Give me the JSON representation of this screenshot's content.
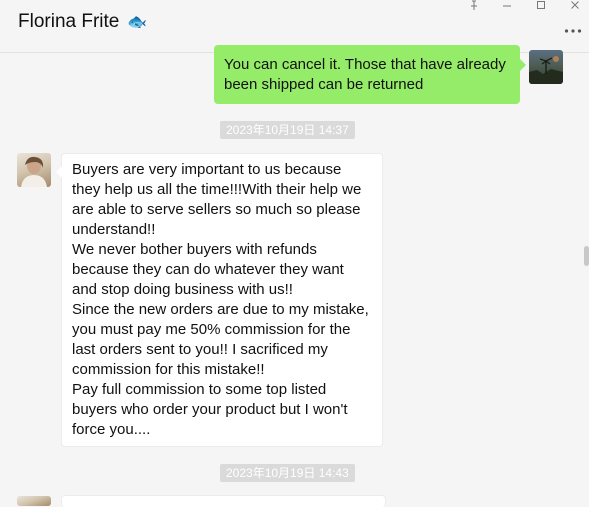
{
  "header": {
    "title": "Florina Frite",
    "title_glyph": "🐟",
    "more_icon": "more-icon"
  },
  "window_controls": {
    "pin": "pin-icon",
    "minimize": "minimize-icon",
    "maximize": "maximize-icon",
    "close": "close-icon"
  },
  "messages": [
    {
      "sender": "self",
      "text": "You can cancel it. Those that have already been shipped can be returned"
    },
    {
      "type": "timestamp",
      "text": "2023年10月19日 14:37"
    },
    {
      "sender": "peer",
      "paragraphs": [
        "Buyers are very important to us because they help us all the time!!!With their help we are able to serve sellers so much so please understand!!",
        "We never bother buyers with refunds because they can do whatever they want and stop doing business with us!!",
        "Since the new orders are due to my mistake, you must pay me 50% commission for the last orders sent to you!! I sacrificed my commission for this mistake!!",
        "Pay full commission to some top listed buyers who order your product but I won't force you...."
      ]
    },
    {
      "type": "timestamp",
      "text": "2023年10月19日 14:43"
    },
    {
      "sender": "peer",
      "text": ""
    }
  ],
  "colors": {
    "self_bubble": "#95ec69",
    "peer_bubble": "#ffffff",
    "background": "#f5f5f5",
    "timestamp_bg": "#dadada"
  }
}
